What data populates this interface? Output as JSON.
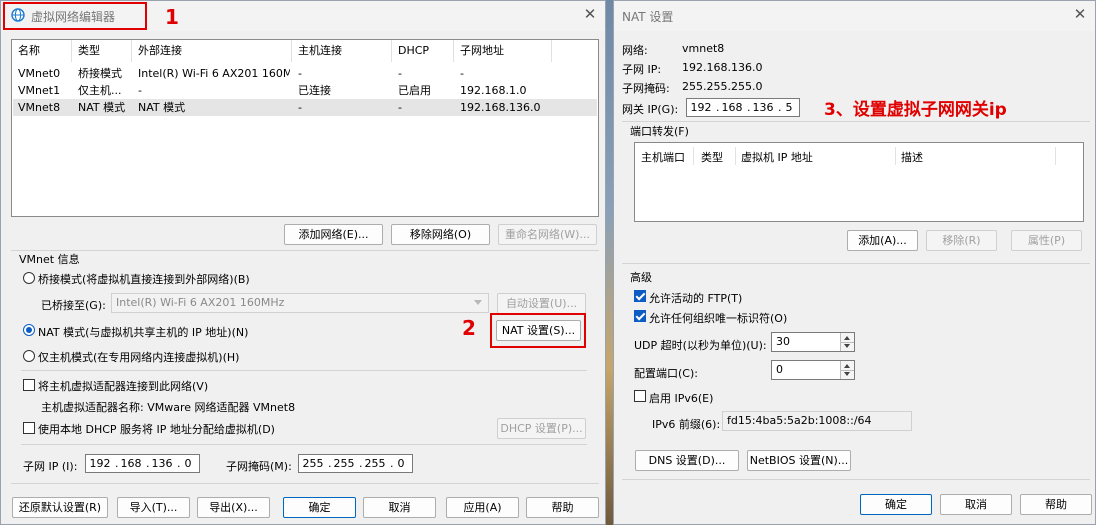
{
  "vne": {
    "title": "虚拟网络编辑器",
    "columns": [
      "名称",
      "类型",
      "外部连接",
      "主机连接",
      "DHCP",
      "子网地址"
    ],
    "rows": [
      {
        "name": "VMnet0",
        "type": "桥接模式",
        "ext": "Intel(R) Wi-Fi 6 AX201 160MHz",
        "host": "-",
        "dhcp": "-",
        "subnet": "-"
      },
      {
        "name": "VMnet1",
        "type": "仅主机...",
        "ext": "-",
        "host": "已连接",
        "dhcp": "已启用",
        "subnet": "192.168.1.0"
      },
      {
        "name": "VMnet8",
        "type": "NAT 模式",
        "ext": "NAT 模式",
        "host": "-",
        "dhcp": "-",
        "subnet": "192.168.136.0"
      }
    ],
    "add_net": "添加网络(E)...",
    "remove_net": "移除网络(O)",
    "rename_net": "重命名网络(W)...",
    "vmnet_info": "VMnet 信息",
    "radio_bridge": "桥接模式(将虚拟机直接连接到外部网络)(B)",
    "bridged_to_label": "已桥接至(G):",
    "bridged_to_value": "Intel(R) Wi-Fi 6 AX201 160MHz",
    "auto_settings": "自动设置(U)...",
    "radio_nat": "NAT 模式(与虚拟机共享主机的 IP 地址)(N)",
    "nat_settings": "NAT 设置(S)...",
    "radio_hostonly": "仅主机模式(在专用网络内连接虚拟机)(H)",
    "check_adapter": "将主机虚拟适配器连接到此网络(V)",
    "adapter_name": "主机虚拟适配器名称: VMware 网络适配器 VMnet8",
    "check_dhcp": "使用本地 DHCP 服务将 IP 地址分配给虚拟机(D)",
    "dhcp_settings": "DHCP 设置(P)...",
    "subnet_ip_label": "子网 IP (I):",
    "subnet_ip": [
      "192",
      "168",
      "136",
      "0"
    ],
    "subnet_mask_label": "子网掩码(M):",
    "subnet_mask": [
      "255",
      "255",
      "255",
      "0"
    ],
    "restore": "还原默认设置(R)",
    "import": "导入(T)...",
    "export": "导出(X)...",
    "ok": "确定",
    "cancel": "取消",
    "apply": "应用(A)",
    "help": "帮助"
  },
  "nat": {
    "title": "NAT 设置",
    "network_label": "网络:",
    "network_value": "vmnet8",
    "subnet_ip_label": "子网 IP:",
    "subnet_ip_value": "192.168.136.0",
    "subnet_mask_label": "子网掩码:",
    "subnet_mask_value": "255.255.255.0",
    "gateway_label": "网关 IP(G):",
    "gateway": [
      "192",
      "168",
      "136",
      "5"
    ],
    "port_forward": "端口转发(F)",
    "pf_columns": [
      "主机端口",
      "类型",
      "虚拟机 IP 地址",
      "描述"
    ],
    "add": "添加(A)...",
    "remove": "移除(R)",
    "props": "属性(P)",
    "advanced": "高级",
    "allow_ftp": "允许活动的 FTP(T)",
    "allow_oui": "允许任何组织唯一标识符(O)",
    "udp_label": "UDP 超时(以秒为单位)(U):",
    "udp_value": "30",
    "config_port_label": "配置端口(C):",
    "config_port_value": "0",
    "enable_ipv6": "启用 IPv6(E)",
    "ipv6_prefix_label": "IPv6 前缀(6):",
    "ipv6_prefix_value": "fd15:4ba5:5a2b:1008::/64",
    "dns": "DNS 设置(D)...",
    "netbios": "NetBIOS 设置(N)...",
    "ok": "确定",
    "cancel": "取消",
    "help": "帮助"
  },
  "annotations": {
    "one": "1",
    "two": "2",
    "three": "3、设置虚拟子网网关ip"
  },
  "colors": {
    "annotation_red": "#e00000",
    "accent_blue": "#0b5cc4"
  }
}
